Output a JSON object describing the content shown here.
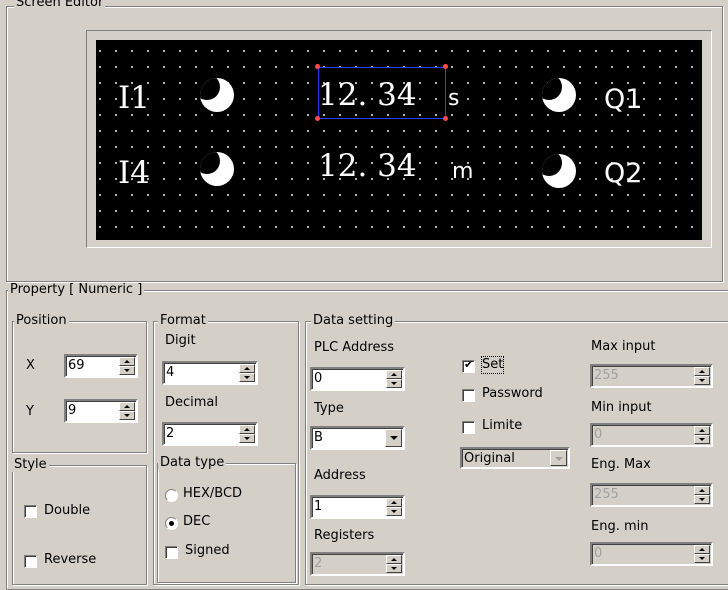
{
  "screen_editor": {
    "legend": "Screen Editor",
    "lcd": {
      "row1": {
        "input_label": "I1",
        "value": "12. 34",
        "unit": "s",
        "output_label": "Q1"
      },
      "row2": {
        "input_label": "I4",
        "value": "12. 34",
        "unit": "m",
        "output_label": "Q2"
      }
    }
  },
  "property": {
    "legend": "Property [ Numeric ]",
    "position": {
      "legend": "Position",
      "x_label": "X",
      "x_value": "69",
      "y_label": "Y",
      "y_value": "9"
    },
    "style": {
      "legend": "Style",
      "double_label": "Double",
      "double_checked": false,
      "reverse_label": "Reverse",
      "reverse_checked": false
    },
    "format": {
      "legend": "Format",
      "digit_label": "Digit",
      "digit_value": "4",
      "decimal_label": "Decimal",
      "decimal_value": "2",
      "data_type": {
        "legend": "Data type",
        "hex_label": "HEX/BCD",
        "dec_label": "DEC",
        "selected": "DEC",
        "signed_label": "Signed",
        "signed_checked": false
      }
    },
    "data_setting": {
      "legend": "Data setting",
      "plc_address_label": "PLC Address",
      "plc_address_value": "0",
      "type_label": "Type",
      "type_value": "B",
      "address_label": "Address",
      "address_value": "1",
      "registers_label": "Registers",
      "registers_value": "2",
      "set_label": "Set",
      "set_checked": true,
      "password_label": "Password",
      "password_checked": false,
      "limite_label": "Limite",
      "limite_checked": false,
      "original_value": "Original",
      "max_input_label": "Max input",
      "max_input_value": "255",
      "min_input_label": "Min input",
      "min_input_value": "0",
      "eng_max_label": "Eng. Max",
      "eng_max_value": "255",
      "eng_min_label": "Eng. min",
      "eng_min_value": "0"
    }
  }
}
